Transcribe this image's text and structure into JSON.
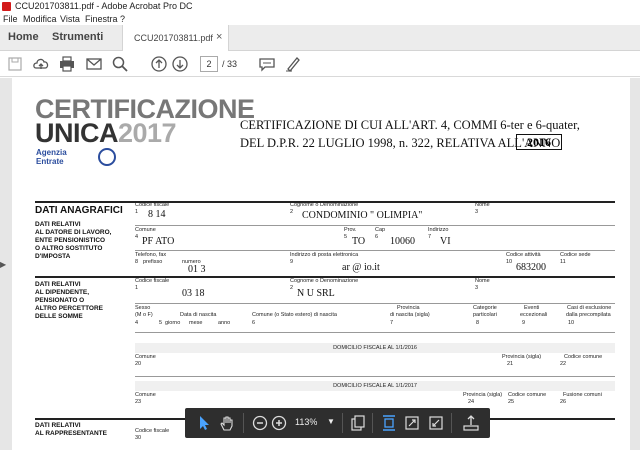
{
  "window": {
    "title": "CCU201703811.pdf - Adobe Acrobat Pro DC"
  },
  "menu": [
    "File",
    "Modifica",
    "Vista",
    "Finestra",
    "?"
  ],
  "tabs": {
    "home": "Home",
    "tools": "Strumenti",
    "document": "CCU201703811.pdf",
    "close": "×"
  },
  "toolbar": {
    "current_page": "2",
    "page_count": "/ 33"
  },
  "floating_toolbar": {
    "zoom": "113%"
  },
  "document": {
    "logo_line1": "CERTIFICAZIONE",
    "logo_line2": "UNICA",
    "logo_year": "2017",
    "logo_agency1": "Agenzia",
    "logo_agency2": "Entrate",
    "heading_line1": "CERTIFICAZIONE DI CUI ALL'ART. 4, COMMI 6-ter e 6-quater,",
    "heading_line2": "DEL D.P.R. 22 LUGLIO 1998, n. 322, RELATIVA ALL'ANNO",
    "year": "2016",
    "sections": {
      "anagrafici_title": "DATI ANAGRAFICI",
      "anagrafici_sub": [
        "DATI RELATIVI",
        "AL DATORE DI LAVORO,",
        "ENTE PENSIONISTICO",
        "O ALTRO SOSTITUTO",
        "D'IMPOSTA"
      ],
      "dipendente_sub": [
        "DATI RELATIVI",
        "AL DIPENDENTE,",
        "PENSIONATO O",
        "ALTRO PERCETTORE",
        "DELLE SOMME"
      ],
      "rappresentante_sub": [
        "DATI RELATIVI",
        "AL RAPPRESENTANTE"
      ]
    },
    "labels": {
      "codice_fiscale": "Codice fiscale",
      "cognome": "Cognome o Denominazione",
      "nome": "Nome",
      "comune": "Comune",
      "prov": "Prov.",
      "cap": "Cap",
      "indirizzo": "Indirizzo",
      "telefono": "Telefono, fax",
      "prefisso": "prefisso",
      "numero": "numero",
      "email": "Indirizzo di posta elettronica",
      "codice_attivita": "Codice attività",
      "codice_sede": "Codice sede",
      "sesso": "Sesso",
      "sesso_hint": "(M o F)",
      "data_nascita": "Data di nascita",
      "giorno": "giorno",
      "mese": "mese",
      "anno": "anno",
      "comune_nascita": "Comune (o Stato estero) di nascita",
      "provincia_nascita": "Provincia",
      "provincia_nascita2": "di nascita (sigla)",
      "categorie": "Categorie",
      "categorie2": "particolari",
      "eventi": "Eventi",
      "eventi2": "eccezionali",
      "casi": "Casi di esclusione",
      "casi2": "dalla precompilata",
      "domicilio_2016": "DOMICILIO FISCALE  AL  1/1/2016",
      "domicilio_2017": "DOMICILIO FISCALE  AL  1/1/2017",
      "provincia_sigla": "Provincia (sigla)",
      "codice_comune": "Codice comune",
      "fusione": "Fusione comuni"
    },
    "values": {
      "cf_datore": "8                    14",
      "denominazione": "CONDOMINIO \" OLIMPIA\"",
      "comune_datore": "PF           ATO",
      "prov": "TO",
      "cap": "10060",
      "indirizzo": "VI",
      "telefono": "01                3",
      "email": "ar              @          io.it",
      "codice_attivita": "683200",
      "cf_dipendente": "03                  18",
      "denominazione_dip": "N                                      U SRL"
    },
    "field_numbers": [
      "1",
      "2",
      "3",
      "4",
      "5",
      "6",
      "7",
      "8",
      "9",
      "10",
      "11",
      "1",
      "2",
      "3",
      "4",
      "5",
      "6",
      "7",
      "8",
      "9",
      "10",
      "20",
      "21",
      "22",
      "23",
      "24",
      "25",
      "26",
      "30"
    ]
  }
}
